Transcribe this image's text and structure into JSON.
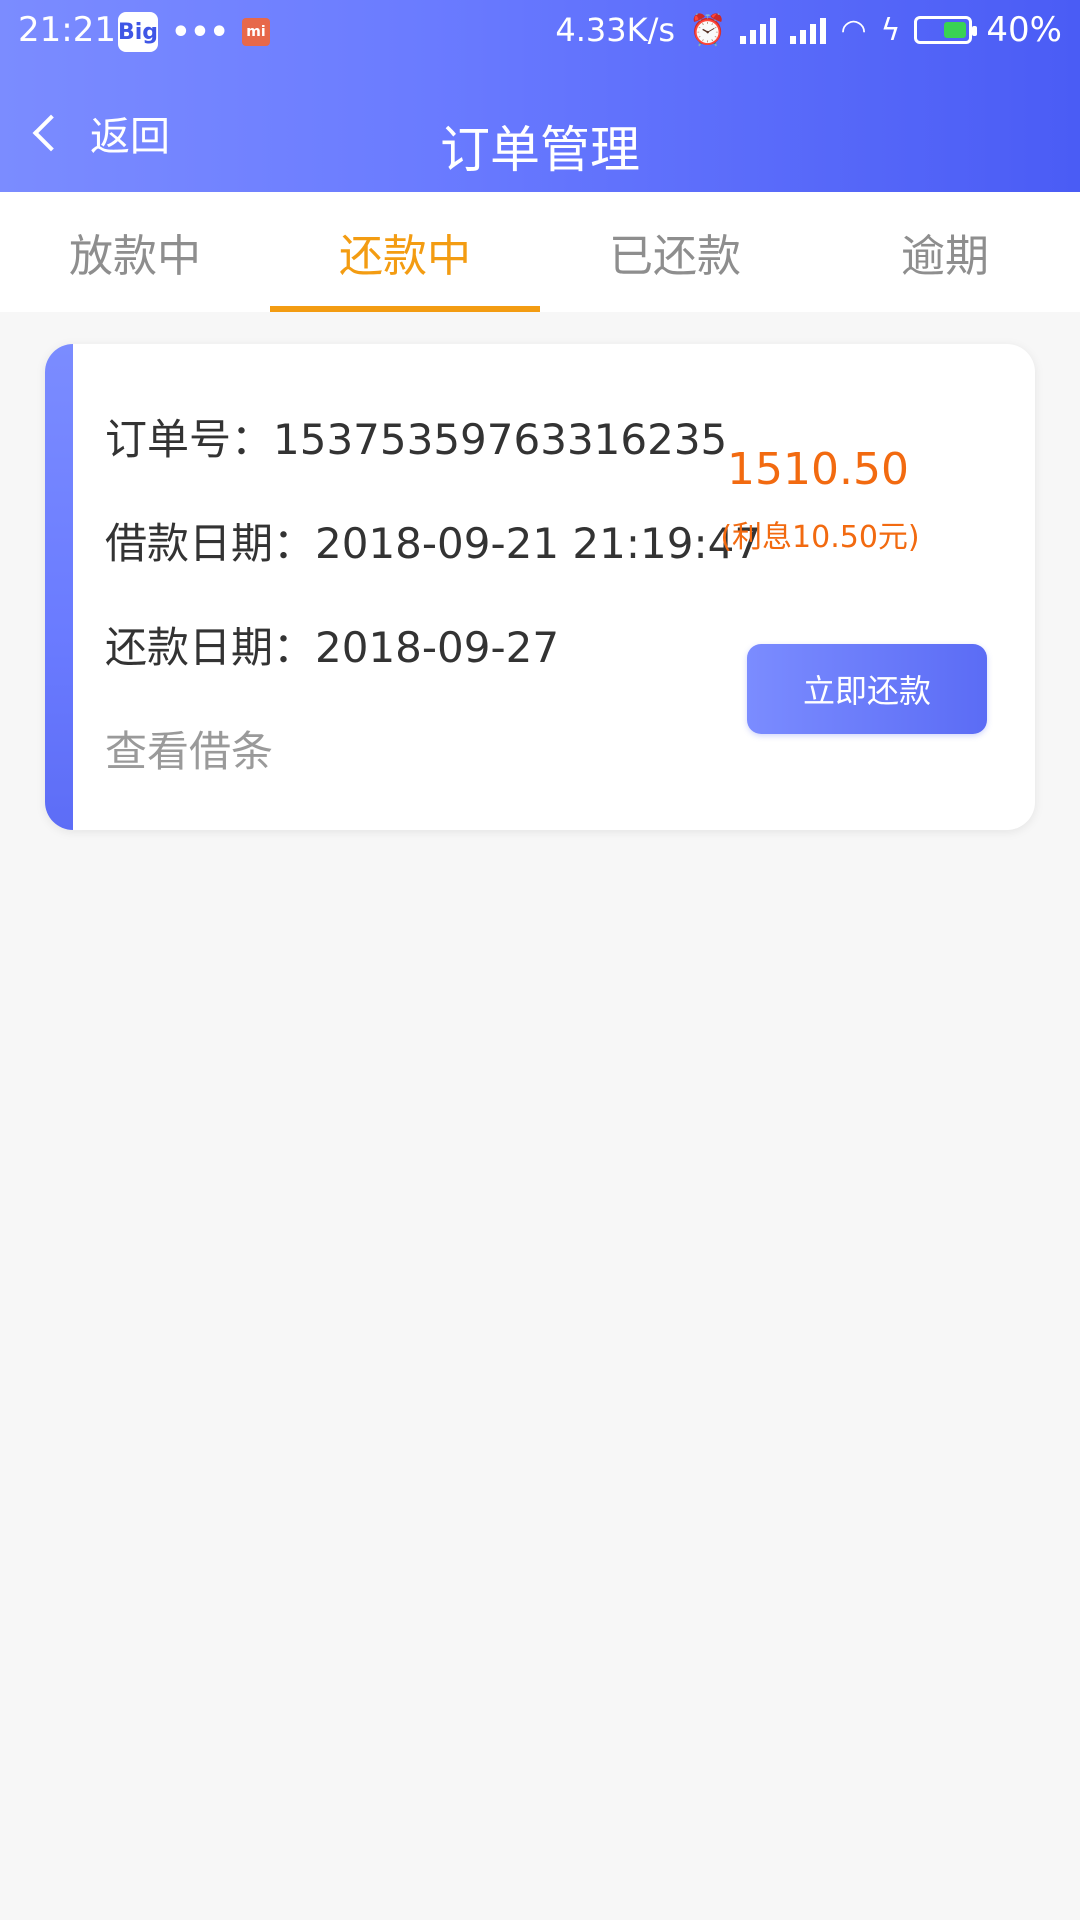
{
  "status_bar": {
    "time": "21:21",
    "net_speed": "4.33K/s",
    "battery": "40%",
    "apps": [
      "Big",
      "chat",
      "mi"
    ]
  },
  "header": {
    "back_label": "返回",
    "title": "订单管理"
  },
  "tabs": [
    {
      "label": "放款中"
    },
    {
      "label": "还款中"
    },
    {
      "label": "已还款"
    },
    {
      "label": "逾期"
    }
  ],
  "order": {
    "order_no": "订单号：15375359763316235",
    "loan_date": "借款日期：2018-09-21 21:19:47",
    "repay_date": "还款日期：2018-09-27",
    "view_note": "查看借条",
    "amount": "1510.50",
    "interest": "(利息10.50元)",
    "pay_button": "立即还款"
  },
  "colors": {
    "primary": "#6a7bff",
    "active_tab": "#f39c12",
    "amount": "#f26a10"
  }
}
